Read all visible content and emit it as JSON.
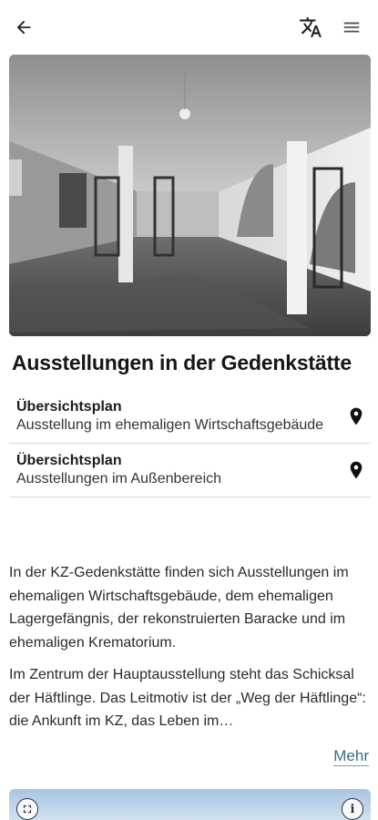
{
  "header": {
    "back_icon": "arrow-left-icon",
    "translate_icon": "translate-icon",
    "menu_icon": "hamburger-menu-icon"
  },
  "page": {
    "title": "Ausstellungen in der Gedenkstätte"
  },
  "plans": [
    {
      "title": "Übersichtsplan",
      "subtitle": "Ausstellung im ehemaligen Wirtschaftsgebäude",
      "icon": "map-pin-icon"
    },
    {
      "title": "Übersichtsplan",
      "subtitle": "Ausstellungen im Außenbereich",
      "icon": "map-pin-icon"
    }
  ],
  "description": {
    "paragraph_1": "In der KZ-Gedenkstätte finden sich Ausstellungen im ehemaligen Wirtschaftsgebäude, dem ehemaligen Lagergefängnis, der rekonstruierten Baracke und im ehemaligen Krematorium.",
    "paragraph_2": "Im Zentrum der Hauptausstellung steht das Schicksal der Häftlinge. Das Leitmotiv ist der „Weg der Häftlinge“: die Ankunft im KZ, das Leben im…",
    "more_label": "Mehr"
  },
  "map": {
    "fullscreen_icon": "fullscreen-icon",
    "info_icon": "info-icon",
    "info_glyph": "i"
  },
  "colors": {
    "link": "#3a6e80",
    "divider": "#d6d6d6"
  }
}
